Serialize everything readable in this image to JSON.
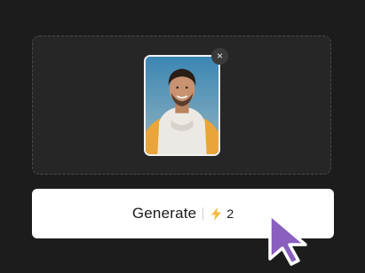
{
  "upload": {
    "remove_icon": "close-icon",
    "remove_glyph": "×"
  },
  "generate_button": {
    "label": "Generate",
    "cost_icon": "lightning-bolt-icon",
    "cost": "2"
  },
  "cursor": {
    "icon": "pointer-cursor-icon",
    "color": "#8a5fc0"
  },
  "colors": {
    "background": "#1c1c1c",
    "dropzone": "#262626",
    "button": "#ffffff",
    "bolt": "#f5b83d"
  }
}
